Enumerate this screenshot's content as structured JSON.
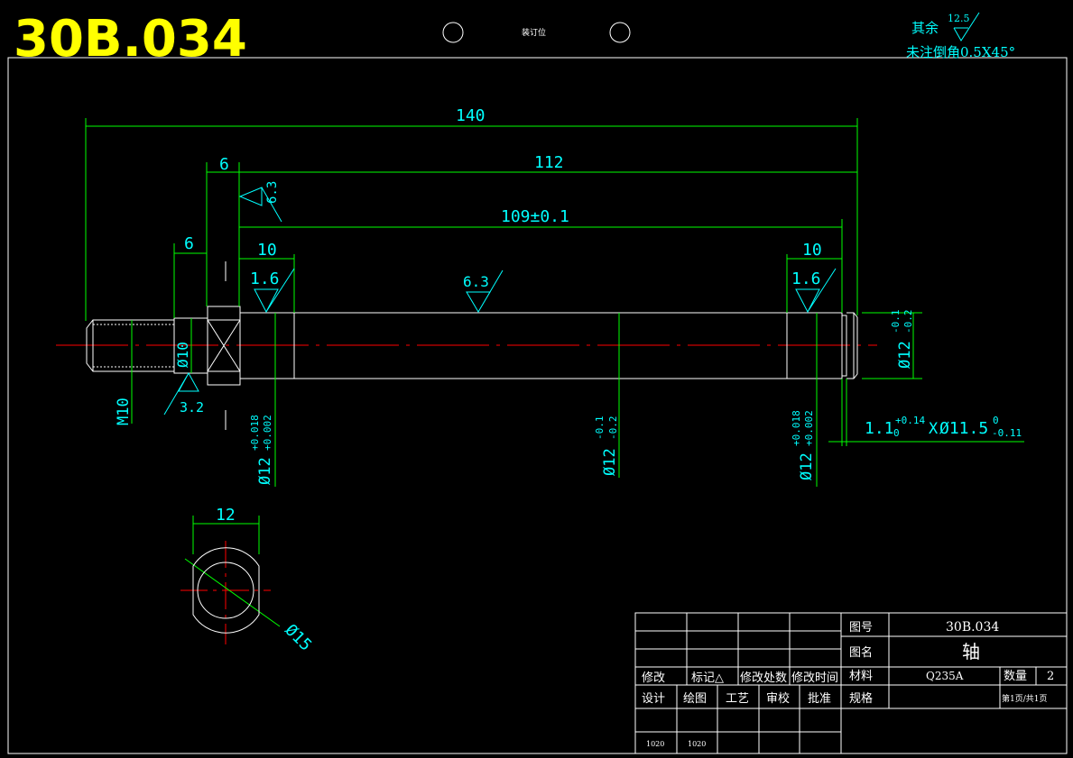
{
  "header": {
    "drawing_code": "30B.034",
    "binding_label": "装订位",
    "surface_rest_label": "其余",
    "surface_rest_value": "12.5",
    "chamfer_note": "未注倒角0.5X45°"
  },
  "dimensions": {
    "overall_length": "140",
    "shaft_length": "112",
    "inner_length": "109±0.1",
    "collar_width": "6",
    "thread_length": "6",
    "left_fit": "10",
    "right_fit": "10",
    "ra_shoulder": "6.3",
    "ra_left": "1.6",
    "ra_mid": "6.3",
    "ra_right": "1.6",
    "ra_thread": "3.2",
    "thread_size": "M10",
    "dia_neck": "Ø10",
    "dia_left": "Ø12",
    "tol_left_upper": "+0.018",
    "tol_left_lower": "+0.002",
    "dia_mid": "Ø12",
    "tol_mid_upper": "-0.1",
    "tol_mid_lower": "-0.2",
    "dia_right": "Ø12",
    "tol_right_upper": "+0.018",
    "tol_right_lower": "+0.002",
    "dia_end": "Ø12",
    "tol_end_upper": "-0.1",
    "tol_end_lower": "-0.2",
    "groove_width": "1.1",
    "groove_width_upper": "+0.14",
    "groove_width_lower": "0",
    "groove_dia_sep": "X",
    "groove_dia": "Ø11.5",
    "groove_dia_upper": "0",
    "groove_dia_lower": "-0.11",
    "section_flat": "12",
    "section_dia": "Ø15"
  },
  "title_block": {
    "rev_headers": [
      "修改",
      "标记△",
      "修改处数",
      "修改时间"
    ],
    "sign_headers": [
      "设计",
      "绘图",
      "工艺",
      "审校",
      "批准"
    ],
    "sign_dates": [
      "1020",
      "1020"
    ],
    "drawing_no_label": "图号",
    "drawing_no": "30B.034",
    "name_label": "图名",
    "name": "轴",
    "material_label": "材料",
    "material": "Q235A",
    "quantity_label": "数量",
    "quantity": "2",
    "spec_label": "规格",
    "page": "第1页/共1页"
  },
  "colors": {
    "background": "#000000",
    "outline": "#ffffff",
    "dimension": "#00ff00",
    "text": "#00ffff",
    "centerline": "#ff0000",
    "code": "#ffff00"
  }
}
